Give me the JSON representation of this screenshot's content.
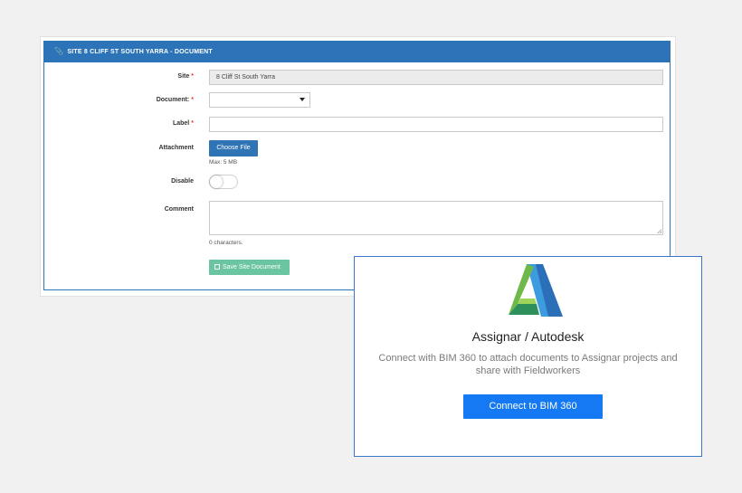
{
  "panel": {
    "header": "SITE 8 CLIFF ST SOUTH YARRA - DOCUMENT"
  },
  "form": {
    "site": {
      "label": "Site",
      "required_mark": "*",
      "value": "8 Cliff St South Yarra"
    },
    "document": {
      "label": "Document:",
      "required_mark": "*",
      "value": ""
    },
    "label_field": {
      "label": "Label",
      "required_mark": "*",
      "value": ""
    },
    "attachment": {
      "label": "Attachment",
      "button": "Choose File",
      "hint": "Max: 5 MB"
    },
    "disable": {
      "label": "Disable",
      "checked": false
    },
    "comment": {
      "label": "Comment",
      "value": "",
      "counter": "0 characters."
    },
    "save_button": "Save Site Document"
  },
  "bim": {
    "title": "Assignar / Autodesk",
    "description": "Connect with BIM 360 to attach documents to Assignar projects and share with Fieldworkers",
    "button": "Connect to BIM 360"
  },
  "colors": {
    "header_blue": "#2c73b8",
    "save_green": "#6bc5a0",
    "connect_blue": "#1479f2",
    "required_red": "#e53935"
  }
}
